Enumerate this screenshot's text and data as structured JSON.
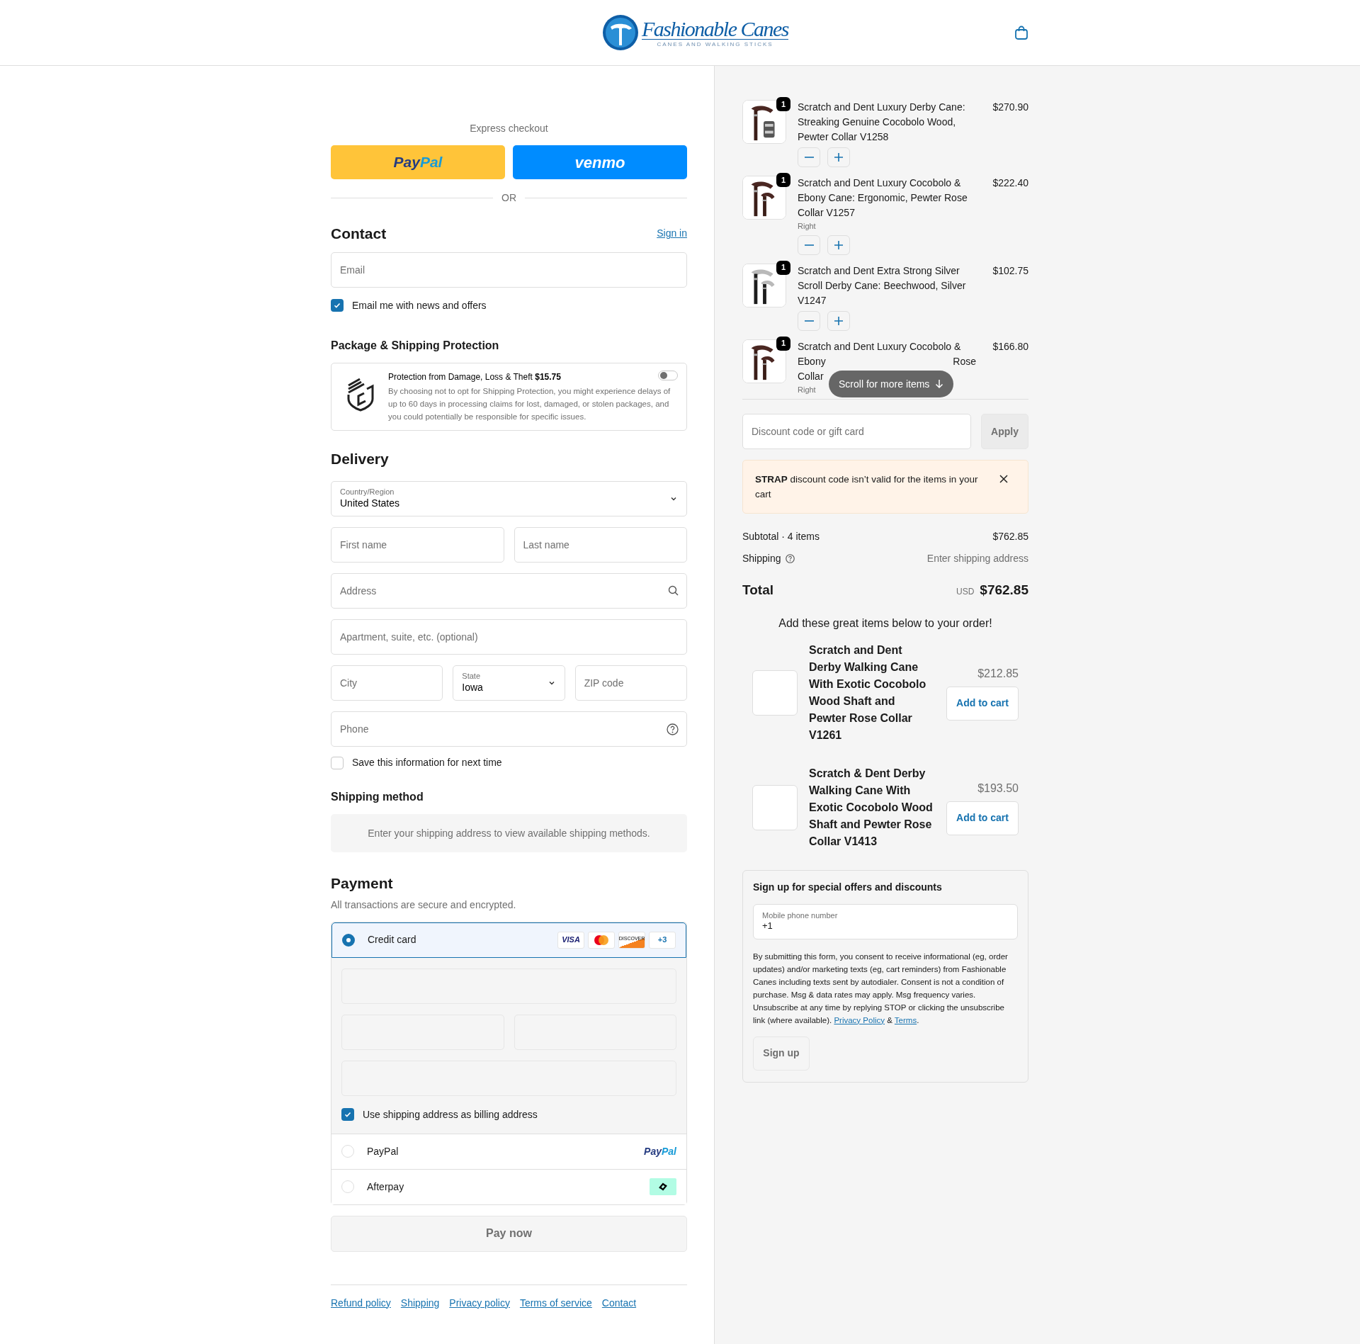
{
  "header": {
    "logo_name": "Fashionable Canes",
    "logo_tagline": "CANES AND WALKING STICKS"
  },
  "express": {
    "title": "Express checkout",
    "buttons": [
      {
        "kind": "paypal",
        "parts": [
          "Pay",
          "Pal"
        ]
      },
      {
        "kind": "venmo",
        "parts": [
          "venmo"
        ]
      }
    ],
    "divider": "OR"
  },
  "contact": {
    "heading": "Contact",
    "sign_in": "Sign in",
    "email": {
      "placeholder": "Email"
    },
    "news": {
      "label": "Email me with news and offers",
      "checked": true
    }
  },
  "protection": {
    "heading": "Package & Shipping Protection",
    "title": "Protection from Damage, Loss & Theft **$15.75**",
    "text": "By choosing not to opt for Shipping Protection, you might experience delays of up to 60 days in processing claims for lost, damaged, or stolen packages, and you could potentially be responsible for specific issues.",
    "on": false
  },
  "delivery": {
    "heading": "Delivery",
    "country": {
      "label": "Country/Region",
      "value": "United States"
    },
    "first_name": {
      "placeholder": "First name"
    },
    "last_name": {
      "placeholder": "Last name"
    },
    "address": {
      "placeholder": "Address"
    },
    "apartment": {
      "placeholder": "Apartment, suite, etc. (optional)"
    },
    "city": {
      "placeholder": "City"
    },
    "state": {
      "label": "State",
      "value": "Iowa"
    },
    "zip": {
      "placeholder": "ZIP code"
    },
    "phone": {
      "placeholder": "Phone"
    },
    "save": {
      "label": "Save this information for next time",
      "checked": false
    }
  },
  "shipping_method": {
    "heading": "Shipping method",
    "message": "Enter your shipping address to view available shipping methods."
  },
  "payment": {
    "heading": "Payment",
    "subtitle": "All transactions are secure and encrypted.",
    "card_brands": [
      {
        "kind": "visa",
        "label": "VISA"
      },
      {
        "kind": "mastercard"
      },
      {
        "kind": "discover",
        "label": "DISCOVER"
      },
      {
        "kind": "more",
        "label": "+3"
      }
    ],
    "methods": [
      {
        "kind": "card",
        "label": "Credit card",
        "selected": true
      },
      {
        "kind": "paypal",
        "label": "PayPal",
        "selected": false,
        "logo": [
          "Pay",
          "Pal"
        ]
      },
      {
        "kind": "afterpay",
        "label": "Afterpay",
        "selected": false
      }
    ],
    "billing": {
      "label": "Use shipping address as billing address",
      "checked": true
    },
    "pay_button": "Pay now"
  },
  "footer_links": [
    "Refund policy",
    "Shipping",
    "Privacy policy",
    "Terms of service",
    "Contact"
  ],
  "cart": {
    "items": [
      {
        "title": "Scratch and Dent Luxury Derby Cane: Streaking Genuine Cocobolo Wood, Pewter Collar V1258",
        "price": "$270.90",
        "quantity": "1"
      },
      {
        "title": "Scratch and Dent Luxury Cocobolo & Ebony Cane: Ergonomic, Pewter Rose Collar V1257",
        "price": "$222.40",
        "quantity": "1",
        "variant": "Right"
      },
      {
        "title": "Scratch and Dent Extra Strong Silver Scroll Derby Cane: Beechwood, Silver V1247",
        "price": "$102.75",
        "quantity": "1"
      },
      {
        "kind": "clipped",
        "title_lines": [
          [
            "Scratch and Dent Luxury Cocobolo &"
          ],
          [
            "Ebony",
            "Rose"
          ],
          [
            "Collar"
          ]
        ],
        "price": "$166.80",
        "quantity": "1",
        "variant": "Right"
      }
    ],
    "scroll_hint": "Scroll for more items"
  },
  "discount": {
    "placeholder": "Discount code or gift card",
    "apply": "Apply"
  },
  "alert": {
    "text": "**STRAP** discount code isn’t valid for the items in your cart"
  },
  "summary": {
    "subtotal_label": "Subtotal · 4 items",
    "subtotal": "$762.85",
    "shipping_label": "Shipping",
    "shipping_value": "Enter shipping address",
    "total_label": "Total",
    "currency": "USD",
    "total": "$762.85"
  },
  "upsell": {
    "title": "Add these great items below to your order!",
    "items": [
      {
        "title": "Scratch and Dent Derby Walking Cane With Exotic Cocobolo Wood Shaft and Pewter Rose Collar V1261",
        "price": "$212.85",
        "button": "Add to cart"
      },
      {
        "title": "Scratch & Dent Derby Walking Cane With Exotic Cocobolo Wood Shaft and Pewter Rose Collar V1413",
        "price": "$193.50",
        "button": "Add to cart"
      }
    ]
  },
  "signup": {
    "heading": "Sign up for special offers and discounts",
    "field_label": "Mobile phone number",
    "field_value": "+1",
    "consent": "By submitting this form, you consent to receive informational (eg, order updates) and/or marketing texts (eg, cart reminders) from Fashionable Canes including texts sent by autodialer. Consent is not a condition of purchase. Msg & data rates may apply. Msg frequency varies. Unsubscribe at any time by replying STOP or clicking the unsubscribe link (where available).",
    "privacy": "Privacy Policy",
    "amp": " & ",
    "terms": "Terms",
    "period": ".",
    "button": "Sign up"
  }
}
